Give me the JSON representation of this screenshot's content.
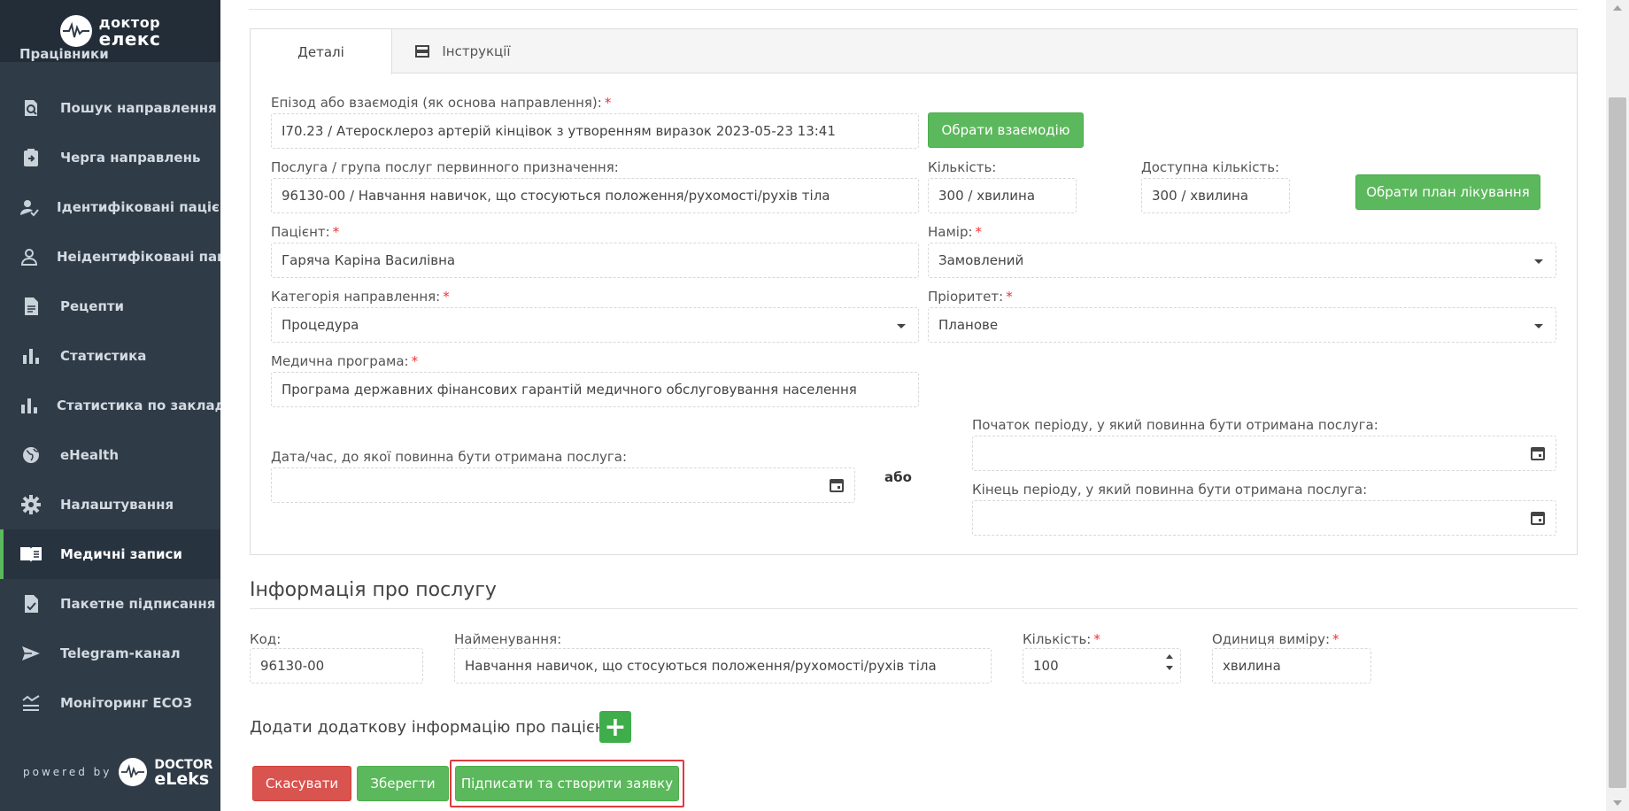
{
  "brand": {
    "line1": "доктор",
    "line2": "елекс"
  },
  "sidebar": {
    "cut_item": "Працівники",
    "items": [
      {
        "label": "Пошук направлення",
        "icon": "search-document-icon"
      },
      {
        "label": "Черга направлень",
        "icon": "clipboard-arrow-icon"
      },
      {
        "label": "Ідентифіковані пацієнти",
        "icon": "user-check-icon"
      },
      {
        "label": "Неідентифіковані паціє...",
        "icon": "user-outline-icon"
      },
      {
        "label": "Рецепти",
        "icon": "document-icon"
      },
      {
        "label": "Статистика",
        "icon": "bar-chart-icon"
      },
      {
        "label": "Статистика по закладу",
        "icon": "bar-chart-icon"
      },
      {
        "label": "eHealth",
        "icon": "globe-icon"
      },
      {
        "label": "Налаштування",
        "icon": "gear-icon"
      },
      {
        "label": "Медичні записи",
        "icon": "book-icon",
        "active": true
      },
      {
        "label": "Пакетне підписання",
        "icon": "signed-document-icon"
      },
      {
        "label": "Telegram-канал",
        "icon": "send-icon"
      },
      {
        "label": "Моніторинг ЕСОЗ",
        "icon": "trend-icon"
      }
    ],
    "powered_label": "powered by",
    "powered_brand_1": "DOCTOR",
    "powered_brand_2": "eLeks"
  },
  "tabs": [
    {
      "label": "Деталі"
    },
    {
      "label": "Інструкції"
    }
  ],
  "form": {
    "episode_label": "Епізод або взаємодія (як основа направлення):",
    "episode_value": "I70.23 / Атеросклероз артерій кінцівок з утворенням виразок 2023-05-23 13:41",
    "choose_interaction": "Обрати взаємодію",
    "service_label": "Послуга / група послуг первинного призначення:",
    "service_value": "96130-00 / Навчання навичок, що стосуються положення/рухомості/рухів тіла",
    "quantity_label": "Кількість:",
    "quantity_value": "300 / хвилина",
    "available_label": "Доступна кількість:",
    "available_value": "300 / хвилина",
    "choose_plan": "Обрати план лікування",
    "patient_label": "Пацієнт:",
    "patient_value": "Гаряча Каріна Василівна",
    "intent_label": "Намір:",
    "intent_value": "Замовлений",
    "category_label": "Категорія направлення:",
    "category_value": "Процедура",
    "priority_label": "Пріоритет:",
    "priority_value": "Планове",
    "program_label": "Медична програма:",
    "program_value": "Програма державних фінансових гарантій медичного обслуговування населення",
    "date_label": "Дата/час, до якої повинна бути отримана послуга:",
    "or_label": "або",
    "period_start_label": "Початок періоду, у який повинна бути отримана послуга:",
    "period_end_label": "Кінець періоду, у який повинна бути отримана послуга:"
  },
  "service_info": {
    "title": "Інформація про послугу",
    "code_label": "Код:",
    "code_value": "96130-00",
    "name_label": "Найменування:",
    "name_value": "Навчання навичок, що стосуються положення/рухомості/рухів тіла",
    "qty_label": "Кількість:",
    "qty_value": "100",
    "unit_label": "Одиниця виміру:",
    "unit_value": "хвилина"
  },
  "extra": {
    "label": "Додати додаткову інформацію про пацієнта",
    "plus": "+"
  },
  "actions": {
    "cancel": "Скасувати",
    "save": "Зберегти",
    "sign": "Підписати та створити заявку"
  },
  "colors": {
    "sidebar": "#2f3b47",
    "accent": "#5cb85c",
    "danger": "#d9534f",
    "highlight": "#e0393e"
  }
}
